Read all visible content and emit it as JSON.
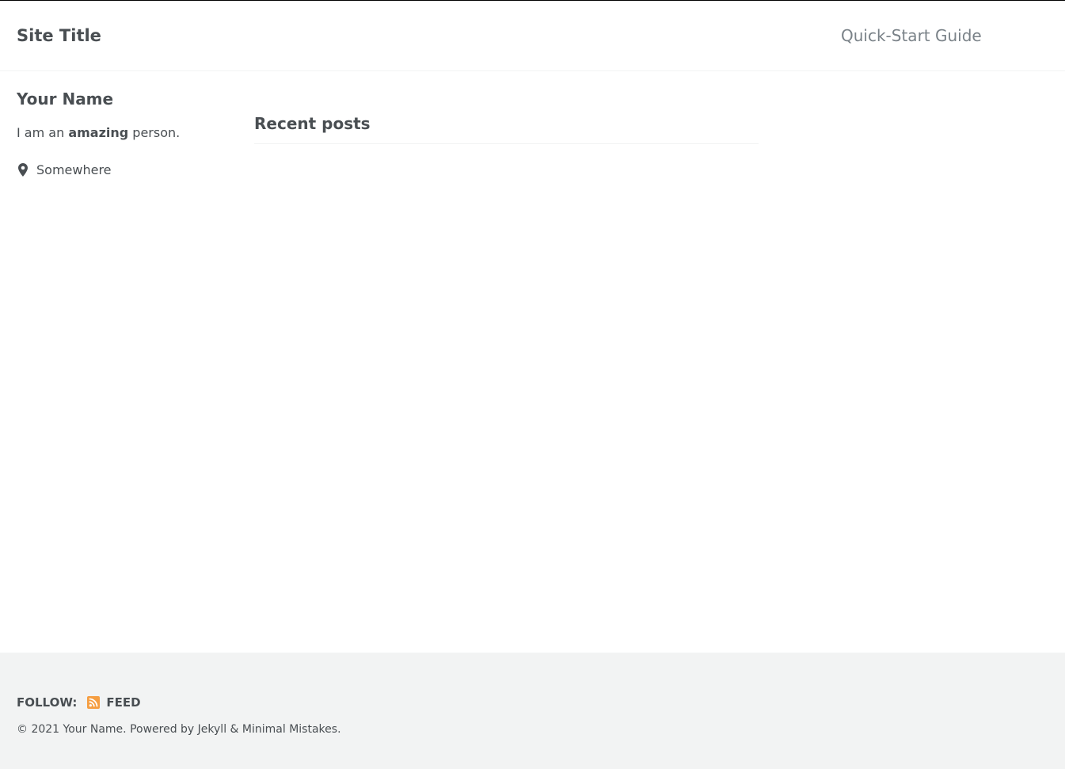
{
  "masthead": {
    "site_title": "Site Title",
    "nav_items": [
      {
        "label": "Quick-Start Guide"
      }
    ]
  },
  "author": {
    "name": "Your Name",
    "bio_prefix": "I am an ",
    "bio_emphasis": "amazing",
    "bio_suffix": " person.",
    "location": "Somewhere",
    "location_icon": "map-marker-icon"
  },
  "main": {
    "section_title": "Recent posts"
  },
  "footer": {
    "follow_label": "Follow:",
    "feed_label": "Feed",
    "feed_icon": "rss-icon",
    "copyright_prefix": "© 2021 Your Name. Powered by ",
    "jekyll_link": "Jekyll",
    "separator": " & ",
    "theme_link": "Minimal Mistakes",
    "copyright_suffix": "."
  },
  "colors": {
    "text": "#494e52",
    "muted_text": "#7a8288",
    "footer_bg": "#f2f3f3",
    "rss_accent": "#f59e42"
  }
}
